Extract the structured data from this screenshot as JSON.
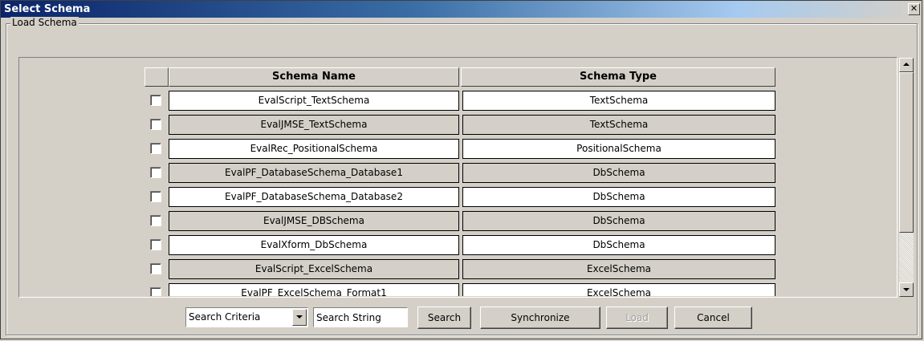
{
  "window": {
    "title": "Select Schema",
    "close_glyph": "✕"
  },
  "group": {
    "legend": "Load Schema"
  },
  "table": {
    "columns": [
      "Schema Name",
      "Schema Type"
    ],
    "rows": [
      {
        "name": "EvalScript_TextSchema",
        "type": "TextSchema"
      },
      {
        "name": "EvalJMSE_TextSchema",
        "type": "TextSchema"
      },
      {
        "name": "EvalRec_PositionalSchema",
        "type": "PositionalSchema"
      },
      {
        "name": "EvalPF_DatabaseSchema_Database1",
        "type": "DbSchema"
      },
      {
        "name": "EvalPF_DatabaseSchema_Database2",
        "type": "DbSchema"
      },
      {
        "name": "EvalJMSE_DBSchema",
        "type": "DbSchema"
      },
      {
        "name": "EvalXform_DbSchema",
        "type": "DbSchema"
      },
      {
        "name": "EvalScript_ExcelSchema",
        "type": "ExcelSchema"
      },
      {
        "name": "EvalPF_ExcelSchema_Format1",
        "type": "ExcelSchema"
      }
    ]
  },
  "footer": {
    "criteria_value": "Search Criteria",
    "search_string_value": "Search String",
    "search_label": "Search",
    "synchronize_label": "Synchronize",
    "load_label": "Load",
    "cancel_label": "Cancel"
  },
  "colors": {
    "title_start": "#0a246a",
    "title_end": "#a6caf0",
    "face": "#d4d0c8"
  }
}
